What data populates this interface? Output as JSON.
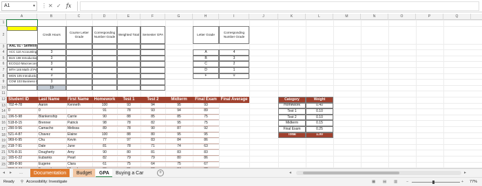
{
  "formula_bar": {
    "name_box": "A1",
    "fx": "fx"
  },
  "columns": [
    "A",
    "B",
    "C",
    "D",
    "E",
    "F",
    "G",
    "H",
    "I",
    "J",
    "K",
    "L",
    "M",
    "N",
    "O",
    "P",
    "Q"
  ],
  "rows": [
    "1",
    "2",
    "3",
    "4",
    "5",
    "6",
    "7",
    "8",
    "9",
    "10",
    "11",
    "12",
    "13",
    "14",
    "15",
    "16",
    "17",
    "18",
    "19",
    "20",
    "21",
    "22",
    "23",
    "24",
    "25"
  ],
  "course_table": {
    "headers": [
      "Credit Hours",
      "Course Letter Grade",
      "Corresponding Number Grade",
      "Weighted Total",
      "Semester GPA"
    ],
    "title": "AAL 01 - Semester #1",
    "courses": [
      "ACC 110 Accounting Concepts I",
      "BUS 108 Introduction to Canadian Business",
      "ECO110 Macroeconomics",
      "MTH 146 Math of Personal Finance",
      "MGN 105 Introduction to Human Resources",
      "COM 103 Business Communication 1"
    ],
    "credit_hours": [
      "3",
      "3",
      "3",
      "4",
      "3",
      "3"
    ],
    "total_credits": "19"
  },
  "grade_table": {
    "headers": [
      "Letter Grade",
      "Corresponding Number Grade"
    ],
    "rows": [
      [
        "A",
        "4"
      ],
      [
        "B",
        "3"
      ],
      [
        "C",
        "2"
      ],
      [
        "D",
        "1"
      ],
      [
        "F",
        "0"
      ]
    ]
  },
  "student_table": {
    "headers": [
      "Student ID",
      "Last Name",
      "First Name",
      "Homework",
      "Test 1",
      "Test 2",
      "Midterm",
      "Final Exam",
      "Final Average"
    ],
    "rows": [
      [
        "702-4-78",
        "Aaron",
        "Kenneth",
        "100",
        "93",
        "94",
        "95",
        "93"
      ],
      [
        "0",
        "0",
        "",
        "91",
        "78",
        "93",
        "94",
        "89"
      ],
      [
        "196-5-98",
        "Blankenship",
        "Carrie",
        "90",
        "88",
        "85",
        "85",
        "75"
      ],
      [
        "518-8-15",
        "Brenner",
        "Patrick",
        "98",
        "78",
        "82",
        "95",
        "75"
      ],
      [
        "290-9-56",
        "Camacho",
        "Melissa",
        "89",
        "78",
        "90",
        "87",
        "92"
      ],
      [
        "521-4-87",
        "Chavez",
        "Elaine",
        "100",
        "88",
        "80",
        "95",
        "95"
      ],
      [
        "969-6-95",
        "Chu",
        "Kevin",
        "77",
        "97",
        "83",
        "84",
        "86"
      ],
      [
        "218-7-91",
        "Dale",
        "June",
        "81",
        "78",
        "71",
        "74",
        "63"
      ],
      [
        "576-8-31",
        "Dougherty",
        "Amy",
        "90",
        "80",
        "81",
        "83",
        "83"
      ],
      [
        "165-6-22",
        "Eubanks",
        "Pearl",
        "82",
        "79",
        "79",
        "80",
        "86"
      ],
      [
        "389-8-90",
        "Eugene",
        "Clara",
        "61",
        "75",
        "64",
        "75",
        "67"
      ],
      [
        "959-4-44",
        "Fernandez",
        "Miguel",
        "86",
        "81",
        "90",
        "84",
        "82"
      ],
      [
        "504-6-73",
        "Kaur",
        "Amanpreet",
        "100",
        "100",
        "100",
        "100",
        "91"
      ]
    ]
  },
  "weights": {
    "headers": [
      "Category",
      "Weight"
    ],
    "rows": [
      [
        "Homework",
        "0.40"
      ],
      [
        "Test 1",
        "0.10"
      ],
      [
        "Test 2",
        "0.10"
      ],
      [
        "Midterm",
        "0.15"
      ],
      [
        "Final Exam",
        "0.25"
      ]
    ],
    "total": [
      "Total",
      "1.00"
    ]
  },
  "tabs": {
    "more": "...",
    "documentation": "Documentation",
    "budget": "Budget",
    "gpa": "GPA",
    "car": "Buying a Car",
    "add": "+"
  },
  "status": {
    "ready": "Ready",
    "accessibility": "Accessibility: Investigate",
    "zoom": "77%"
  },
  "colors": {
    "accent_red": "#a0412e",
    "tab_orange": "#e07b2e",
    "title_yellow": "#ffff00",
    "total_gray": "#c7cfd8"
  }
}
